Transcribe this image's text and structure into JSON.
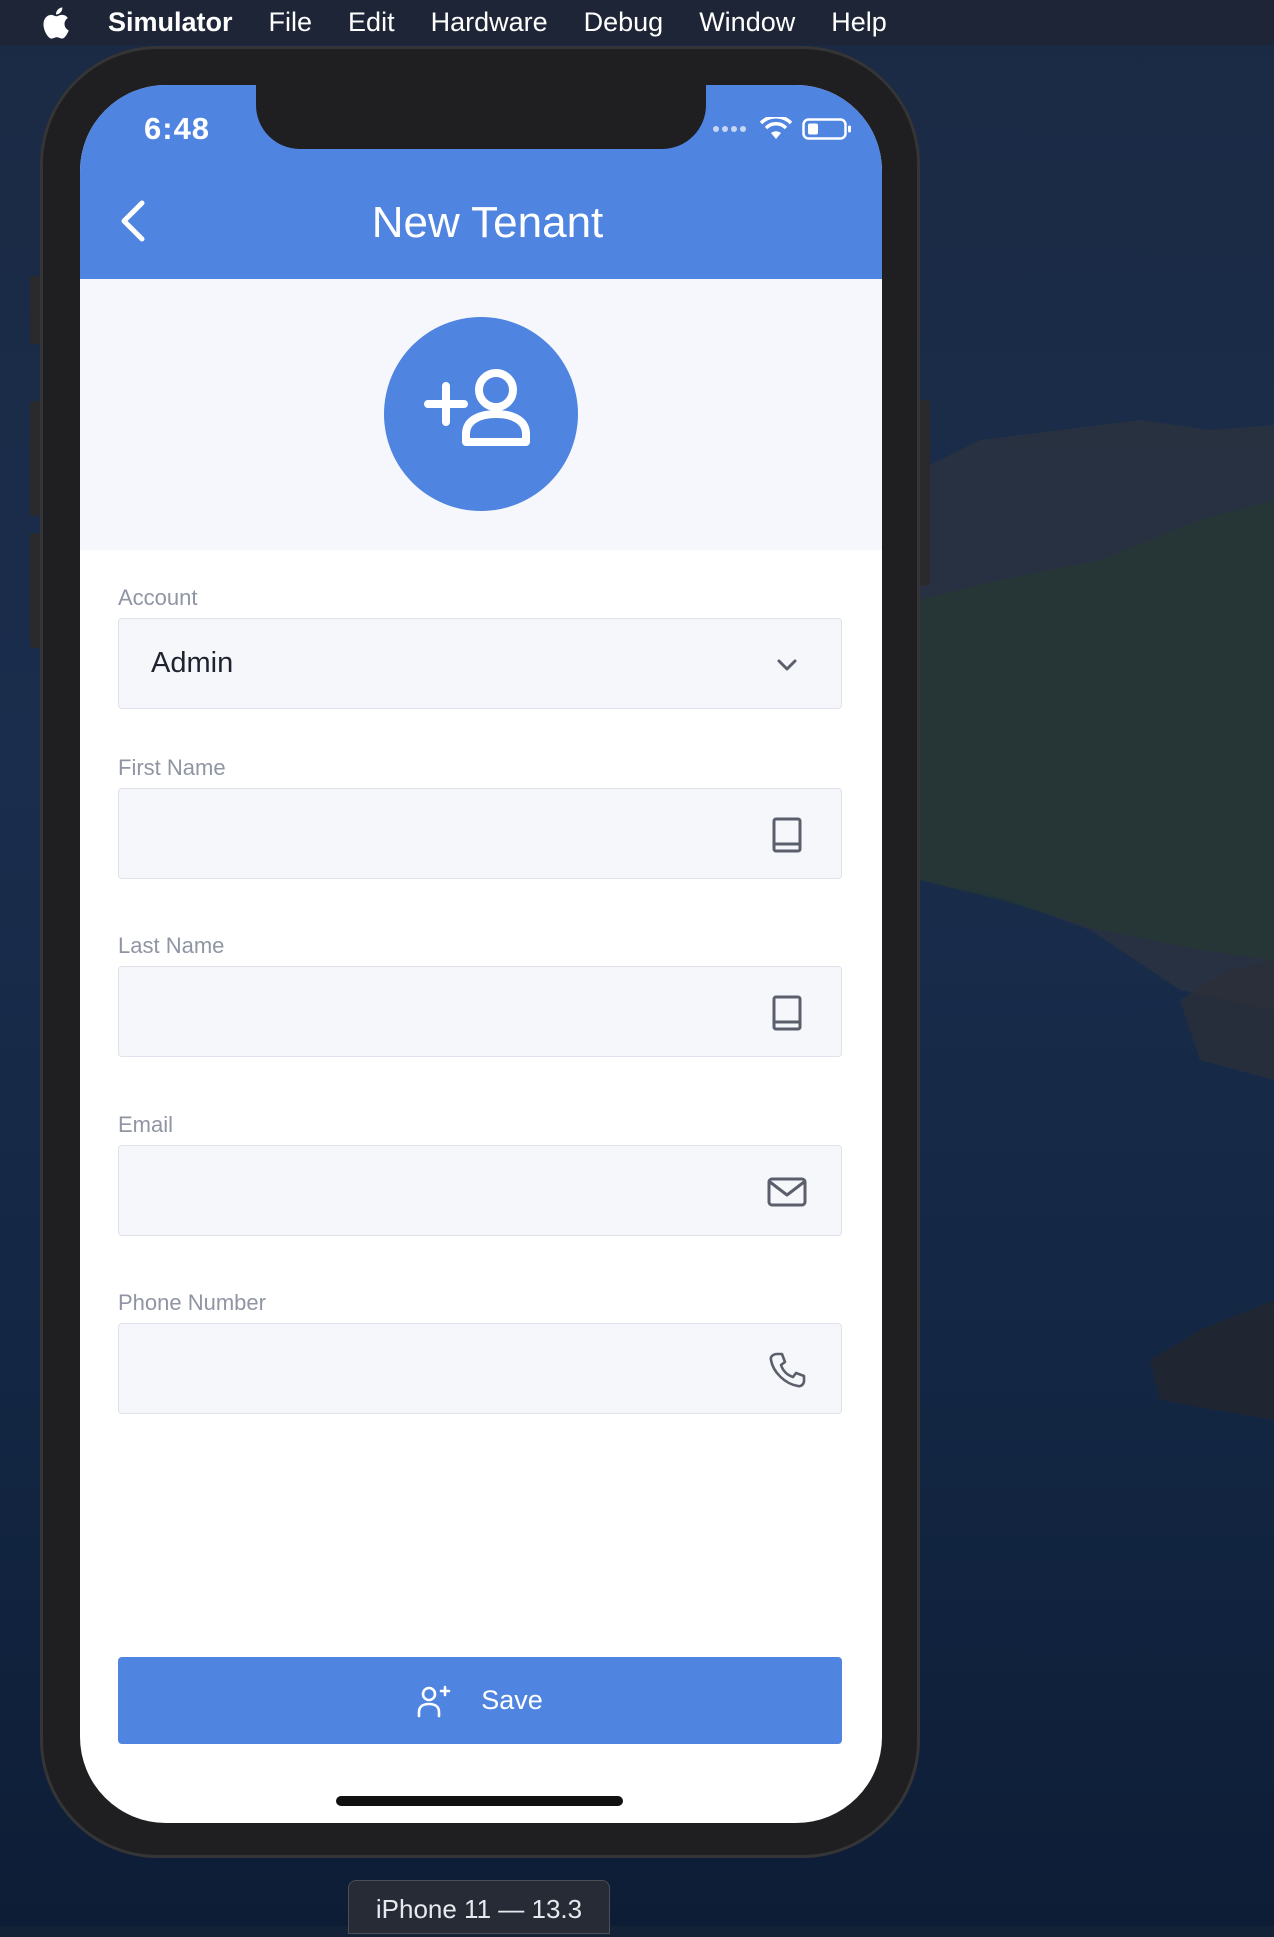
{
  "menubar": {
    "app_name": "Simulator",
    "items": [
      "File",
      "Edit",
      "Hardware",
      "Debug",
      "Window",
      "Help"
    ]
  },
  "status_bar": {
    "time": "6:48"
  },
  "nav": {
    "title": "New Tenant"
  },
  "form": {
    "account": {
      "label": "Account",
      "value": "Admin"
    },
    "first_name": {
      "label": "First Name",
      "value": ""
    },
    "last_name": {
      "label": "Last Name",
      "value": ""
    },
    "email": {
      "label": "Email",
      "value": ""
    },
    "phone": {
      "label": "Phone Number",
      "value": ""
    }
  },
  "save_button": {
    "label": "Save"
  },
  "device_label": "iPhone 11 — 13.3",
  "colors": {
    "accent": "#4f84e0",
    "field_bg": "#f6f7fb",
    "label": "#8f95a3"
  },
  "icons": {
    "back": "chevron-left-icon",
    "avatar": "add-user-icon",
    "account": "chevron-down-icon",
    "first_name": "book-icon",
    "last_name": "book-icon",
    "email": "mail-icon",
    "phone": "phone-icon",
    "save": "add-user-icon"
  }
}
